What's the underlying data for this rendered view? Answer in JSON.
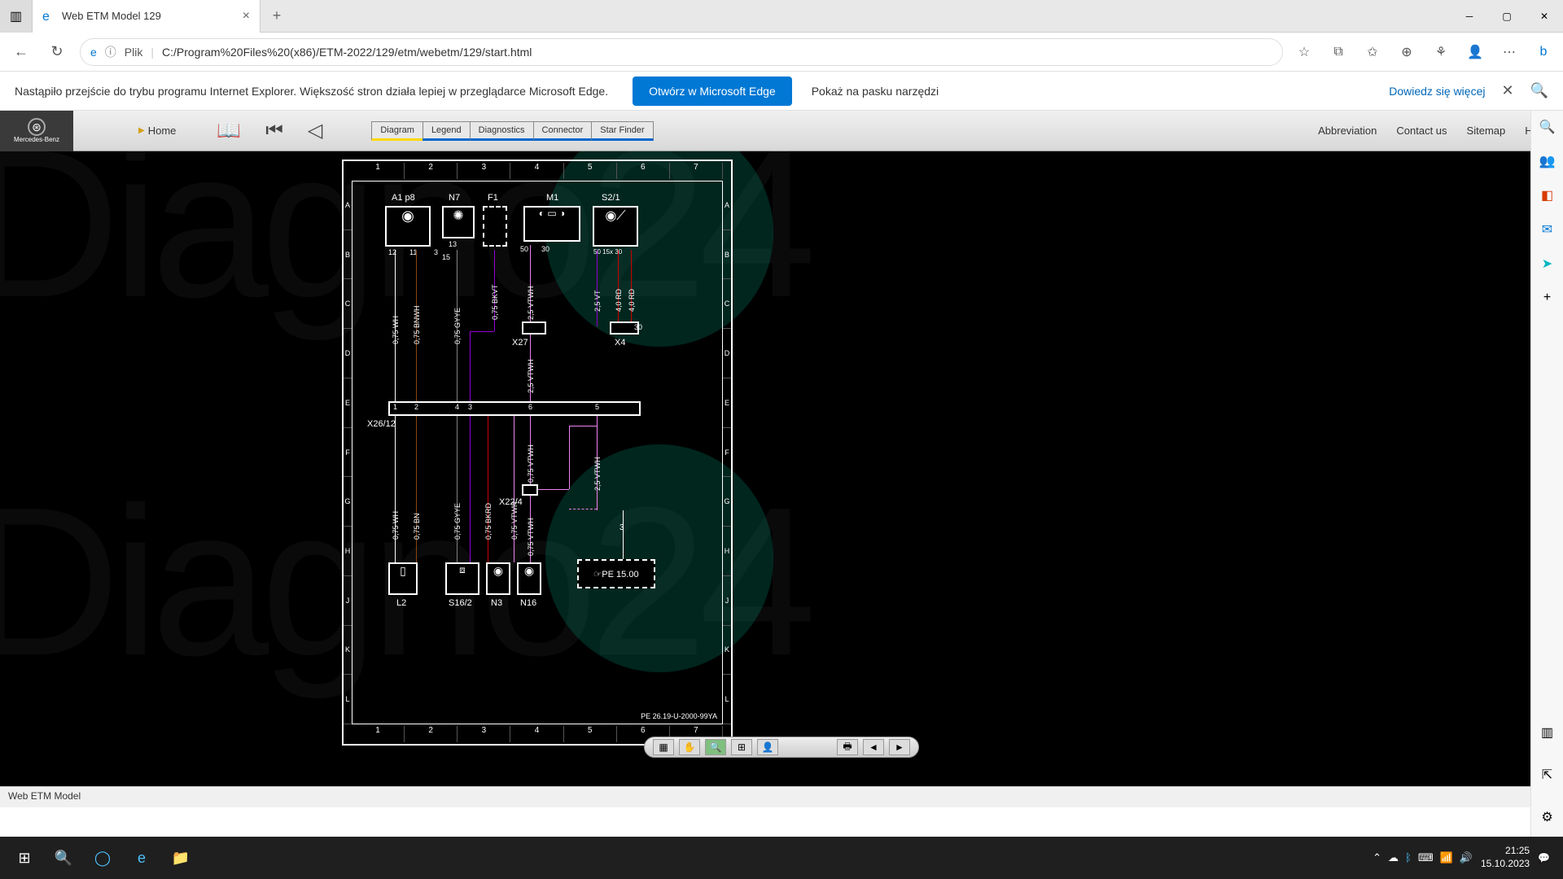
{
  "browser": {
    "tab_title": "Web ETM Model 129",
    "url_prefix": "Plik",
    "url": "C:/Program%20Files%20(x86)/ETM-2022/129/etm/webetm/129/start.html",
    "notify_text": "Nastąpiło przejście do trybu programu Internet Explorer. Większość stron działa lepiej w przeglądarce Microsoft Edge.",
    "open_btn": "Otwórz w Microsoft Edge",
    "show_btn": "Pokaż na pasku narzędzi",
    "learn_more": "Dowiedz się więcej"
  },
  "app": {
    "brand": "Mercedes-Benz",
    "home": "Home",
    "tabs": {
      "diagram": "Diagram",
      "legend": "Legend",
      "diagnostics": "Diagnostics",
      "connector": "Connector",
      "starfinder": "Star Finder"
    },
    "nav": {
      "abbr": "Abbreviation",
      "contact": "Contact us",
      "sitemap": "Sitemap",
      "help": "Help"
    }
  },
  "diagram": {
    "cols": [
      "1",
      "2",
      "3",
      "4",
      "5",
      "6",
      "7"
    ],
    "rows": [
      "A",
      "B",
      "C",
      "D",
      "E",
      "F",
      "G",
      "H",
      "J",
      "K",
      "L"
    ],
    "components": {
      "a1": "A1 p8",
      "n7": "N7",
      "f1": "F1",
      "m1": "M1",
      "s21": "S2/1",
      "x27": "X27",
      "x4": "X4",
      "x2612": "X26/12",
      "x224": "X22/4",
      "l2": "L2",
      "s162": "S16/2",
      "n3": "N3",
      "n16": "N16",
      "pe": "☞PE 15.00",
      "foot": "PE 26.19-U-2000-99YA",
      "pin12": "12",
      "pin11": "11",
      "pin13": "13",
      "pin3r": "3",
      "pin15": "15",
      "pin50": "50",
      "pin30": "30",
      "pin30b": "30",
      "pin3b": "3",
      "s21_pins": "50 15x 30"
    },
    "wires": {
      "w075wh": "0,75 WH",
      "w075bnwh": "0,75 BNWH",
      "w075gyye": "0,75 GYYE",
      "w075bkvt": "0,75 BKVT",
      "w25vtwh": "2,5 VTWH",
      "w25vt": "2,5 VT",
      "w40rd": "4,0 RD",
      "w075bn": "0,75 BN",
      "w075bkrd": "0,75 BKRD",
      "w075vtwh": "0,75 VTWH"
    },
    "bus_pins": {
      "p1": "1",
      "p2": "2",
      "p4": "4",
      "p3": "3",
      "p6": "6",
      "p5": "5"
    }
  },
  "status": {
    "text": "Web ETM Model"
  },
  "taskbar": {
    "time": "21:25",
    "date": "15.10.2023"
  },
  "watermark": "Diagno24"
}
